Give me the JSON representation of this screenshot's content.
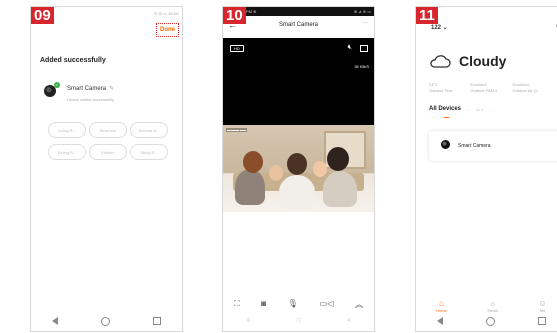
{
  "steps": [
    "09",
    "10",
    "11"
  ],
  "phone1": {
    "status_right": "⊙ ◎ ▭ 10:44",
    "done": "Done",
    "heading": "Added successfully",
    "device_name": "Smart Camera",
    "device_status": "Device added successfully",
    "room_chips": [
      "Living R...",
      "Bedroom",
      "Second B...",
      "Dining R...",
      "Kitchen",
      "Study R..."
    ]
  },
  "phone2": {
    "status_left": "PM ⊕",
    "status_right": "⊕ ⊿ ≋ ▭",
    "title": "Smart Camera",
    "more": "···",
    "hd": "HD",
    "rate": "35 KB/S",
    "controls": [
      "screenshot-icon",
      "camera-icon",
      "microphone-icon",
      "record-icon",
      "expand-icon"
    ]
  },
  "phone3": {
    "home_label": "122 ⌄",
    "weather": "Cloudy",
    "stats": [
      {
        "value": "24°C",
        "label": "Outdoor Tem..."
      },
      {
        "value": "Excellent",
        "label": "Outdoor PM2.5"
      },
      {
        "value": "Excellent",
        "label": "Outdoor Air Q..."
      }
    ],
    "tabs": [
      "All Devices",
      "...",
      "Li..r",
      "..."
    ],
    "device": "Smart Camera",
    "bottom_nav": [
      {
        "icon": "home-icon",
        "label": "Home"
      },
      {
        "icon": "smart-icon",
        "label": "Smart"
      },
      {
        "icon": "me-icon",
        "label": "Me"
      }
    ]
  }
}
